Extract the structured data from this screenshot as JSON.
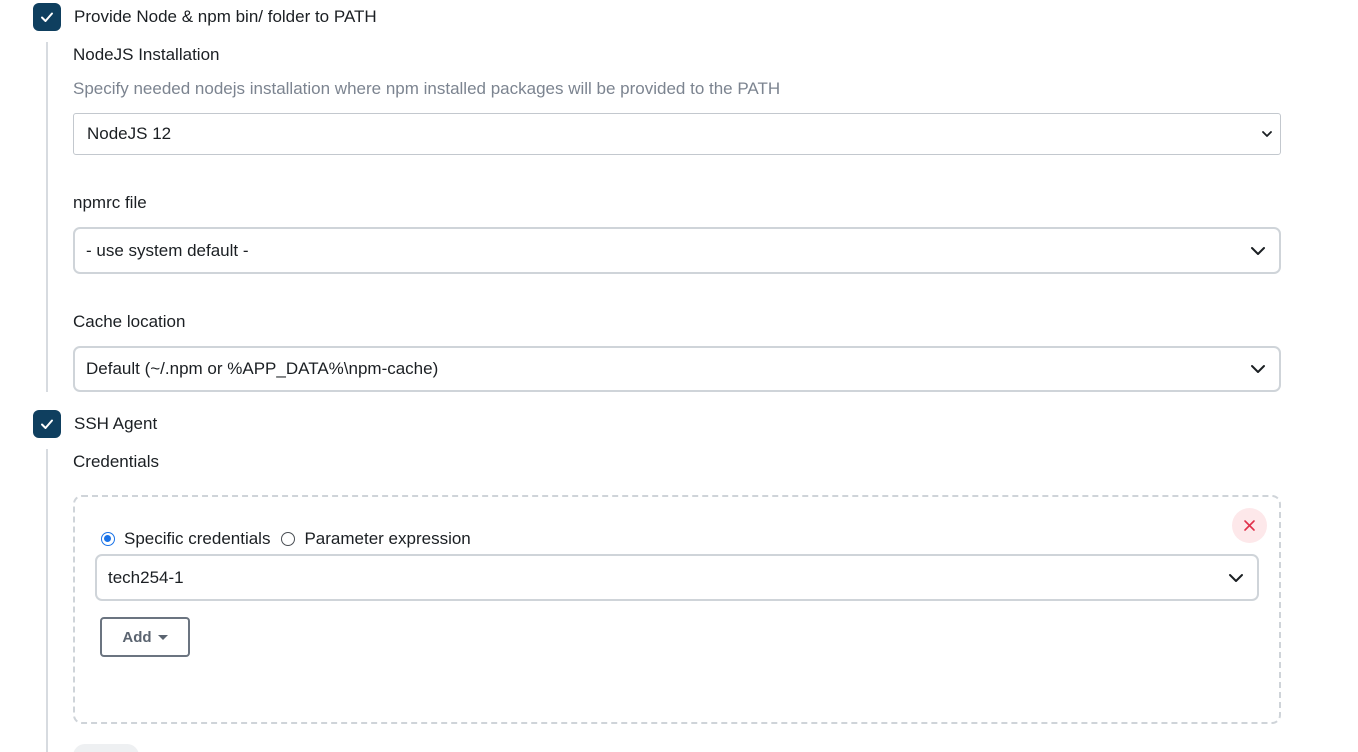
{
  "node_section": {
    "checkbox_label": "Provide Node & npm bin/ folder to PATH",
    "checked": true,
    "nodejs_installation": {
      "label": "NodeJS Installation",
      "help": "Specify needed nodejs installation where npm installed packages will be provided to the PATH",
      "selected": "NodeJS 12"
    },
    "npmrc": {
      "label": "npmrc file",
      "selected": "- use system default -"
    },
    "cache": {
      "label": "Cache location",
      "selected": "Default (~/.npm or %APP_DATA%\\npm-cache)"
    }
  },
  "ssh_section": {
    "checkbox_label": "SSH Agent",
    "checked": true,
    "credentials": {
      "label": "Credentials",
      "radio_specific": "Specific credentials",
      "radio_parameter": "Parameter expression",
      "selected_radio": "Specific credentials",
      "selected": "tech254-1",
      "add_label": "Add"
    }
  },
  "colors": {
    "checkbox_bg": "#0f3f5f",
    "radio_accent": "#1a73e8",
    "close_bg": "#fde8ea",
    "close_icon": "#e0314b"
  },
  "icons": {
    "checkbox": "checkmark-icon",
    "select": "chevron-down-icon",
    "remove": "close-icon",
    "add_dropdown": "caret-down-icon"
  }
}
